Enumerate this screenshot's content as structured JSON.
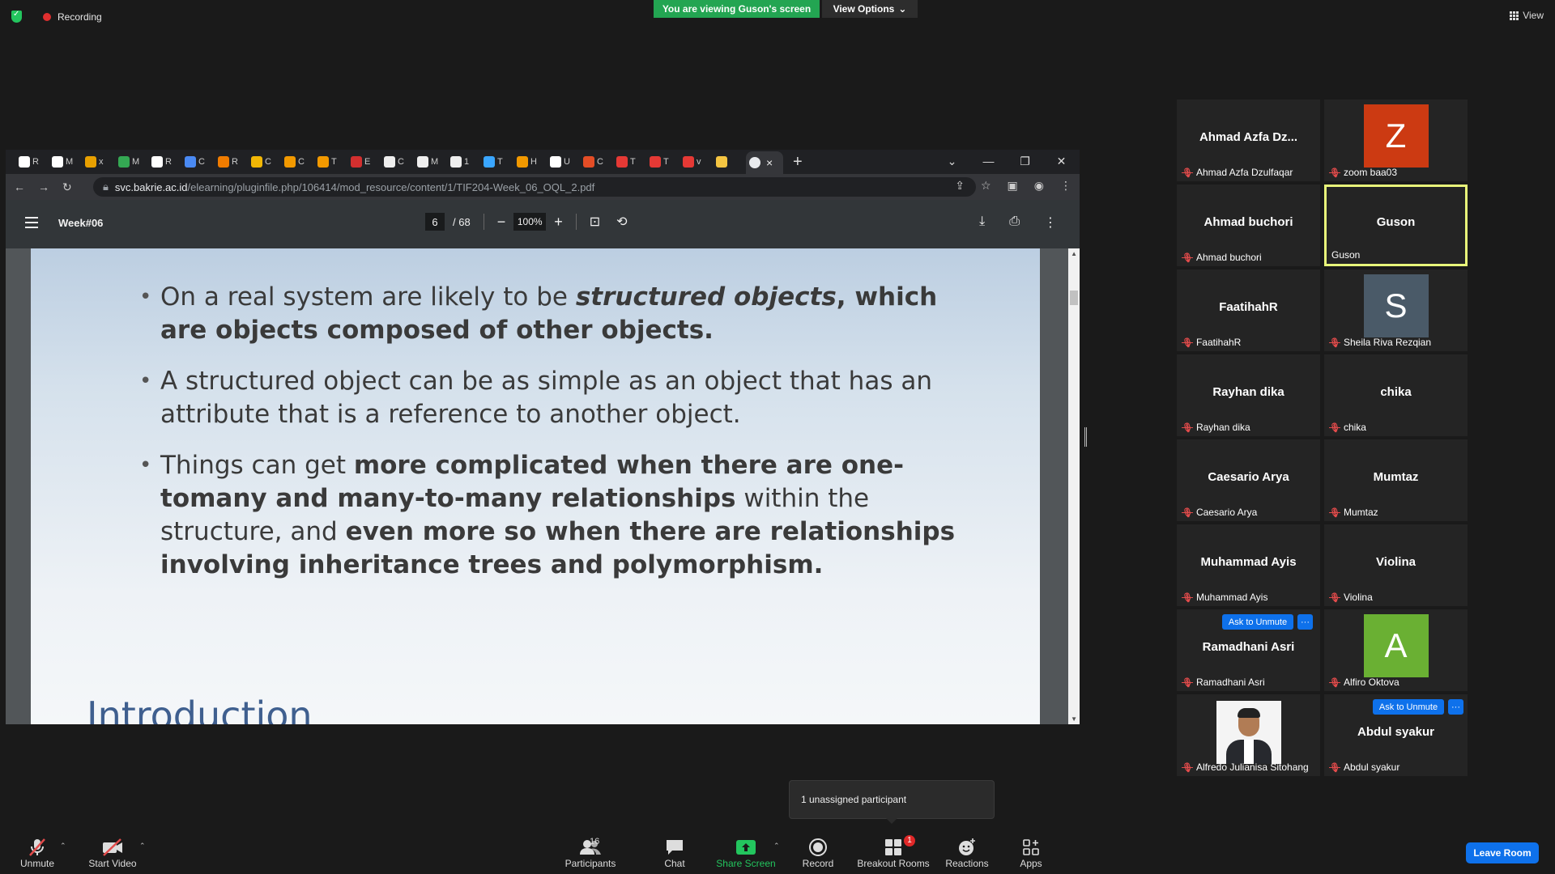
{
  "zoom_top": {
    "recording_label": "Recording",
    "viewing_banner": "You are viewing Guson's screen",
    "view_options_label": "View Options",
    "view_label": "View"
  },
  "browser": {
    "tabs": [
      {
        "icon": "chrome-icon",
        "letter": "R",
        "color": "#ffffff"
      },
      {
        "icon": "globe-icon",
        "letter": "M",
        "color": "#ffffff"
      },
      {
        "icon": "esc-icon",
        "letter": "x",
        "color": "#e8a000"
      },
      {
        "icon": "sheet-icon",
        "letter": "M",
        "color": "#34a853"
      },
      {
        "icon": "globe-icon",
        "letter": "R",
        "color": "#ffffff"
      },
      {
        "icon": "scholar-icon",
        "letter": "C",
        "color": "#4a8af4"
      },
      {
        "icon": "uf-icon",
        "letter": "R",
        "color": "#f07c00"
      },
      {
        "icon": "star-icon",
        "letter": "C",
        "color": "#f2b705"
      },
      {
        "icon": "slides-icon",
        "letter": "C",
        "color": "#f29900"
      },
      {
        "icon": "slides-icon",
        "letter": "T",
        "color": "#f29900"
      },
      {
        "icon": "k-icon",
        "letter": "E",
        "color": "#d32f2f"
      },
      {
        "icon": "doc-icon",
        "letter": "C",
        "color": "#eeeeee"
      },
      {
        "icon": "doc-icon",
        "letter": "M",
        "color": "#eeeeee"
      },
      {
        "icon": "doc-icon",
        "letter": "1",
        "color": "#eeeeee"
      },
      {
        "icon": "pen-icon",
        "letter": "T",
        "color": "#3aa6ff"
      },
      {
        "icon": "slides-icon",
        "letter": "H",
        "color": "#f29900"
      },
      {
        "icon": "globe-icon",
        "letter": "U",
        "color": "#ffffff"
      },
      {
        "icon": "html5-icon",
        "letter": "C",
        "color": "#e44d26"
      },
      {
        "icon": "red-icon",
        "letter": "T",
        "color": "#e53935"
      },
      {
        "icon": "red-icon",
        "letter": "T",
        "color": "#e53935"
      },
      {
        "icon": "red-icon",
        "letter": "v",
        "color": "#e53935"
      },
      {
        "icon": "hand-icon",
        "letter": "",
        "color": "#f5c542"
      }
    ],
    "active_tab_close": "×",
    "url_domain": "svc.bakrie.ac.id",
    "url_path": "/elearning/pluginfile.php/106414/mod_resource/content/1/TIF204-Week_06_OQL_2.pdf"
  },
  "pdf": {
    "title": "Week#06",
    "page_current": "6",
    "page_total": "/ 68",
    "zoom": "100%"
  },
  "slide": {
    "bullets": [
      {
        "parts": [
          {
            "text": "On a real system are likely to be ",
            "style": "normal"
          },
          {
            "text": "structured objects",
            "style": "bolditalic"
          },
          {
            "text": ", which are objects composed of other objects.",
            "style": "bold"
          }
        ]
      },
      {
        "parts": [
          {
            "text": "A structured object can be as simple as an object that has an attribute that is a reference to another object.",
            "style": "normal"
          }
        ]
      },
      {
        "parts": [
          {
            "text": "Things can get ",
            "style": "normal"
          },
          {
            "text": "more complicated when there are one-tomany and many-to-many relationships",
            "style": "bold"
          },
          {
            "text": " within the structure, and ",
            "style": "normal"
          },
          {
            "text": "even more so when there are relationships involving inheritance trees and polymorphism.",
            "style": "bold"
          }
        ]
      }
    ],
    "next_heading": "Introduction"
  },
  "participants": [
    {
      "display": "Ahmad Azfa Dz...",
      "label": "Ahmad Azfa Dzulfaqar",
      "type": "name"
    },
    {
      "display": "Z",
      "label": "zoom baa03",
      "type": "avatar",
      "color": "#cc3a12"
    },
    {
      "display": "Ahmad buchori",
      "label": "Ahmad buchori",
      "type": "name"
    },
    {
      "display": "Guson",
      "label": "Guson",
      "type": "name",
      "speaking": true
    },
    {
      "display": "FaatihahR",
      "label": "FaatihahR",
      "type": "name"
    },
    {
      "display": "S",
      "label": "Sheila Riva Rezqian",
      "type": "avatar",
      "color": "#4a5a68"
    },
    {
      "display": "Rayhan dika",
      "label": "Rayhan dika",
      "type": "name"
    },
    {
      "display": "chika",
      "label": "chika",
      "type": "name"
    },
    {
      "display": "Caesario Arya",
      "label": "Caesario Arya",
      "type": "name"
    },
    {
      "display": "Mumtaz",
      "label": "Mumtaz",
      "type": "name"
    },
    {
      "display": "Muhammad Ayis",
      "label": "Muhammad Ayis",
      "type": "name"
    },
    {
      "display": "Violina",
      "label": "Violina",
      "type": "name"
    },
    {
      "display": "Ramadhani Asri",
      "label": "Ramadhani Asri",
      "type": "name",
      "ask": true
    },
    {
      "display": "A",
      "label": "Alfiro Oktova",
      "type": "avatar",
      "color": "#6ab033"
    },
    {
      "display": "",
      "label": "Alfredo Julianisa Sitohang",
      "type": "photo"
    },
    {
      "display": "Abdul syakur",
      "label": "Abdul syakur",
      "type": "name",
      "ask": true
    }
  ],
  "ask_to_unmute_label": "Ask to Unmute",
  "more_label": "···",
  "tooltip": "1 unassigned participant",
  "toolbar": {
    "unmute": "Unmute",
    "start_video": "Start Video",
    "participants": "Participants",
    "participants_count": "16",
    "chat": "Chat",
    "share_screen": "Share Screen",
    "record": "Record",
    "breakout_rooms": "Breakout Rooms",
    "breakout_badge": "1",
    "reactions": "Reactions",
    "apps": "Apps",
    "leave_room": "Leave Room"
  },
  "colors": {
    "share_green": "#23a552",
    "zoom_blue": "#0e71eb",
    "speaker_highlight": "#e8f57a",
    "muted_red": "#e24b4b"
  }
}
